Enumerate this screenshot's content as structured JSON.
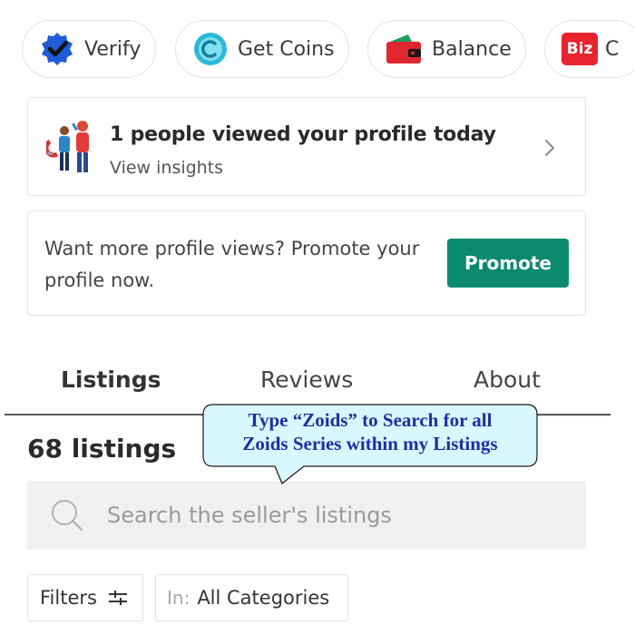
{
  "chips": [
    {
      "label": "Verify",
      "icon": "verified-badge-icon"
    },
    {
      "label": "Get Coins",
      "icon": "coin-icon"
    },
    {
      "label": "Balance",
      "icon": "wallet-icon"
    },
    {
      "label": "C",
      "icon": "biz-icon",
      "badge": "Biz"
    }
  ],
  "insights": {
    "title": "1 people viewed your profile today",
    "subtitle": "View insights"
  },
  "promo": {
    "text": "Want more profile views? Promote your profile now.",
    "button": "Promote"
  },
  "tabs": [
    {
      "label": "Listings",
      "active": true
    },
    {
      "label": "Reviews",
      "active": false
    },
    {
      "label": "About",
      "active": false
    }
  ],
  "listing_count": "68 listings",
  "search": {
    "placeholder": "Search the seller's listings"
  },
  "filters": {
    "label": "Filters",
    "category_prefix": "In:",
    "category_value": "All Categories"
  },
  "callout": {
    "line1": "Type “Zoids” to Search for all",
    "line2": "Zoids Series within my Listings"
  },
  "colors": {
    "accent": "#0b8a6e",
    "callout_fill": "#d9f7ff",
    "callout_text": "#1c2fa5",
    "biz_red": "#e8222e"
  }
}
